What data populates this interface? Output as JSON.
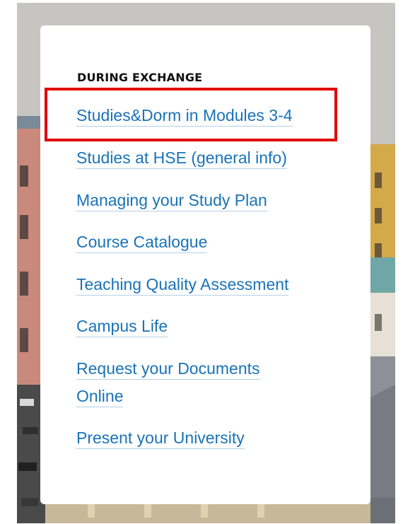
{
  "background": {
    "description_icon": "city-street-photo",
    "sky_color": "#c9c9c7",
    "building_color": "#c98a7c",
    "accent_building_color": "#d4a94a"
  },
  "menu": {
    "heading": "DURING EXCHANGE",
    "link_color": "#1a73b7",
    "links": [
      {
        "label": "Studies&Dorm in Modules 3-4"
      },
      {
        "label": "Studies at HSE (general info)"
      },
      {
        "label": "Managing your Study Plan"
      },
      {
        "label": "Course Catalogue"
      },
      {
        "label": "Teaching Quality Assessment"
      },
      {
        "label": "Campus Life"
      },
      {
        "label": "Request your Documents"
      },
      {
        "label": "Online"
      },
      {
        "label": "Present your University"
      }
    ]
  },
  "annotation": {
    "highlight_color": "#e00000"
  }
}
